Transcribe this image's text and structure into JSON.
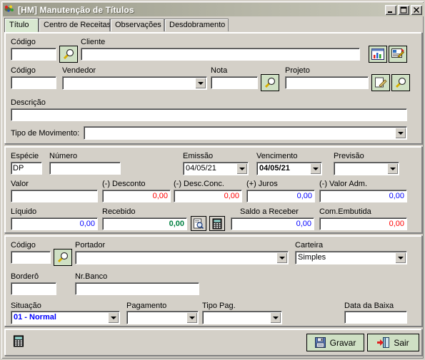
{
  "window": {
    "title": "[HM] Manutenção de Títulos",
    "icon": "app-icon",
    "buttons": {
      "minimize": "minimize-icon",
      "maximize": "maximize-icon",
      "close": "close-icon"
    }
  },
  "tabs": [
    {
      "label": "Título",
      "active": true
    },
    {
      "label": "Centro de Receitas",
      "active": false
    },
    {
      "label": "Observações",
      "active": false
    },
    {
      "label": "Desdobramento",
      "active": false
    }
  ],
  "section_client": {
    "codigo_label": "Código",
    "codigo_value": "",
    "codigo_search_icon": "magnifier-icon",
    "cliente_label": "Cliente",
    "cliente_value": "",
    "chart_button_icon": "chart-icon",
    "edit_client_button_icon": "edit-photo-icon",
    "codigo2_label": "Código",
    "codigo2_value": "",
    "vendedor_label": "Vendedor",
    "vendedor_value": "",
    "nota_label": "Nota",
    "nota_value": "",
    "nota_search_icon": "magnifier-icon",
    "projeto_label": "Projeto",
    "projeto_value": "",
    "projeto_edit_icon": "pencil-page-icon",
    "projeto_search_icon": "magnifier-icon",
    "descricao_label": "Descrição",
    "descricao_value": "",
    "tipo_movimento_label": "Tipo de Movimento:",
    "tipo_movimento_value": ""
  },
  "section_values": {
    "especie_label": "Espécie",
    "especie_value": "DP",
    "numero_label": "Número",
    "numero_value": "",
    "emissao_label": "Emissão",
    "emissao_value": "04/05/21",
    "vencimento_label": "Vencimento",
    "vencimento_value": "04/05/21",
    "previsao_label": "Previsão",
    "previsao_value": "",
    "valor_label": "Valor",
    "valor_value": "",
    "desconto_label": "(-) Desconto",
    "desconto_value": "0,00",
    "desc_conc_label": "(-) Desc.Conc.",
    "desc_conc_value": "0,00",
    "juros_label": "(+) Juros",
    "juros_value": "0,00",
    "valor_adm_label": "(-) Valor Adm.",
    "valor_adm_value": "0,00",
    "liquido_label": "Líquido",
    "liquido_value": "0,00",
    "recebido_label": "Recebido",
    "recebido_value": "0,00",
    "recebido_detail_icon": "magnifier-page-icon",
    "recebido_calc_icon": "calculator-icon",
    "saldo_calc_icon": "calculator-icon",
    "saldo_label": "Saldo a Receber",
    "saldo_value": "0,00",
    "com_embutida_label": "Com.Embutida",
    "com_embutida_value": "0,00"
  },
  "section_bank": {
    "codigo_label": "Código",
    "codigo_value": "",
    "codigo_search_icon": "magnifier-icon",
    "portador_label": "Portador",
    "portador_value": "",
    "carteira_label": "Carteira",
    "carteira_value": "Simples",
    "bordero_label": "Borderô",
    "bordero_value": "",
    "nr_banco_label": "Nr.Banco",
    "nr_banco_value": "",
    "situacao_label": "Situação",
    "situacao_value": "01 - Normal",
    "pagamento_label": "Pagamento",
    "pagamento_value": "",
    "tipo_pag_label": "Tipo Pag.",
    "tipo_pag_value": "",
    "data_baixa_label": "Data da Baixa",
    "data_baixa_value": ""
  },
  "footer": {
    "calculator_icon": "calculator-icon",
    "save_label": "Gravar",
    "save_icon": "floppy-disk-icon",
    "exit_label": "Sair",
    "exit_icon": "exit-door-icon"
  },
  "colors": {
    "window_face": "#d4d0c8",
    "active_tab": "#d8e8d0",
    "button_face": "#cfe0c4",
    "negative": "#ff0000",
    "positive": "#0000ff",
    "received": "#008040"
  }
}
